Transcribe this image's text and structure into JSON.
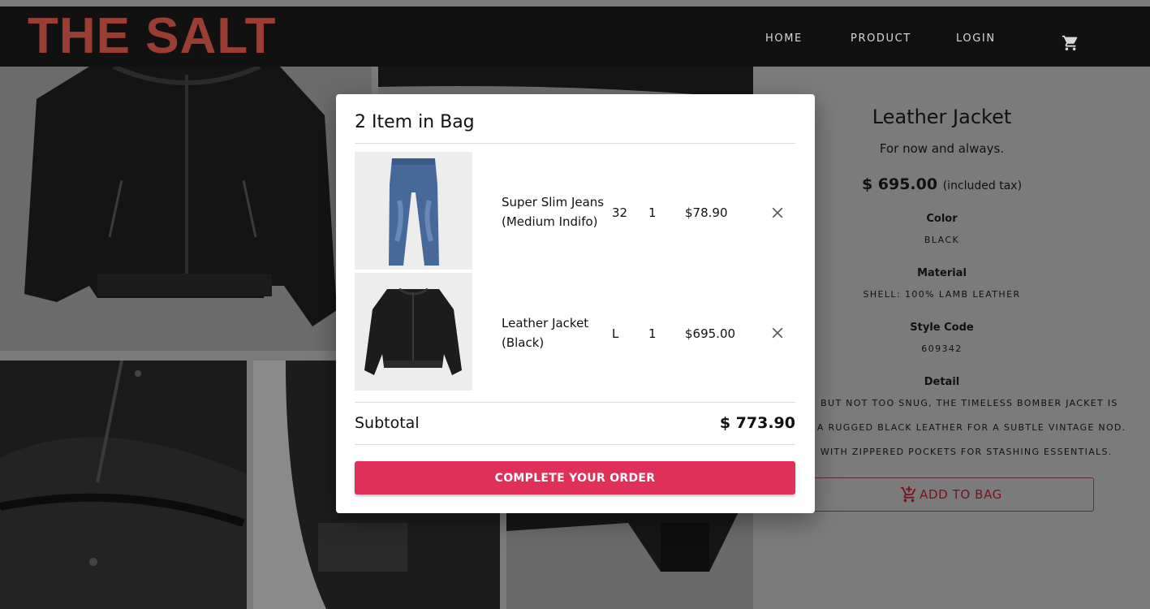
{
  "navbar": {
    "logo": "THE SALT",
    "links": [
      "HOME",
      "PRODUCT",
      "LOGIN"
    ],
    "cart_icon": "cart-icon"
  },
  "product": {
    "title": "Leather Jacket",
    "tagline": "For now and always.",
    "price": "$ 695.00",
    "price_note": "(included tax)",
    "color_label": "Color",
    "color_value": "BLACK",
    "material_label": "Material",
    "material_value": "SHELL: 100% LAMB LEATHER",
    "style_code_label": "Style Code",
    "style_code_value": "609342",
    "detail_label": "Detail",
    "detail_lines": [
      "AN BUT NOT TOO SNUG, THE TIMELESS BOMBER JACKET IS",
      "IN A RUGGED BLACK LEATHER FOR A SUBTLE VINTAGE NOD.",
      "ED WITH ZIPPERED POCKETS FOR STASHING ESSENTIALS."
    ],
    "add_to_bag": "ADD TO BAG"
  },
  "bag": {
    "title": "2 Item in Bag",
    "items": [
      {
        "name_line1": "Super Slim Jeans",
        "name_line2": "(Medium Indifo)",
        "size": "32",
        "qty": "1",
        "price": "$78.90",
        "image": "jeans"
      },
      {
        "name_line1": "Leather Jacket",
        "name_line2": "(Black)",
        "size": "L",
        "qty": "1",
        "price": "$695.00",
        "image": "leather-jacket"
      }
    ],
    "subtotal_label": "Subtotal",
    "subtotal_value": "$ 773.90",
    "cta": "COMPLETE YOUR ORDER"
  },
  "colors": {
    "brand": "#9a3e34",
    "cta": "#e0305a",
    "navbar": "#111111"
  }
}
